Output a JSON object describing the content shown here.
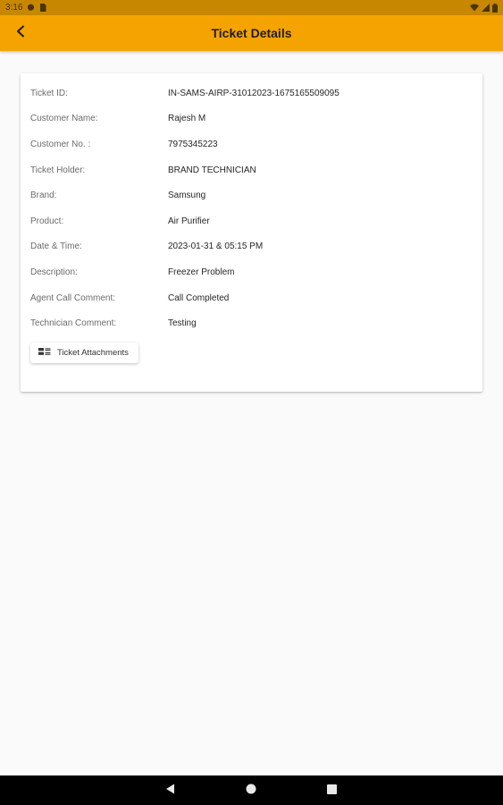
{
  "status_bar": {
    "time": "3:16",
    "icons": [
      "message-icon",
      "sim-icon",
      "wifi-icon",
      "signal-icon",
      "battery-icon"
    ]
  },
  "app_bar": {
    "title": "Ticket Details",
    "back_icon": "chevron-left-icon",
    "color": "#f5a300"
  },
  "details": [
    {
      "label": "Ticket ID:",
      "value": "IN-SAMS-AIRP-31012023-1675165509095"
    },
    {
      "label": "Customer Name:",
      "value": "Rajesh M"
    },
    {
      "label": "Customer No. :",
      "value": "7975345223"
    },
    {
      "label": "Ticket Holder:",
      "value": "BRAND TECHNICIAN"
    },
    {
      "label": "Brand:",
      "value": "Samsung"
    },
    {
      "label": "Product:",
      "value": "Air Purifier"
    },
    {
      "label": "Date & Time:",
      "value": "2023-01-31 & 05:15 PM"
    },
    {
      "label": "Description:",
      "value": "Freezer Problem"
    },
    {
      "label": "Agent Call Comment:",
      "value": "Call Completed"
    },
    {
      "label": "Technician Comment:",
      "value": "Testing"
    }
  ],
  "attachments_button": {
    "label": "Ticket Attachments",
    "icon": "attachments-grid-icon"
  },
  "nav_bar": {
    "buttons": [
      "back-triangle-icon",
      "home-circle-icon",
      "recents-square-icon"
    ]
  }
}
